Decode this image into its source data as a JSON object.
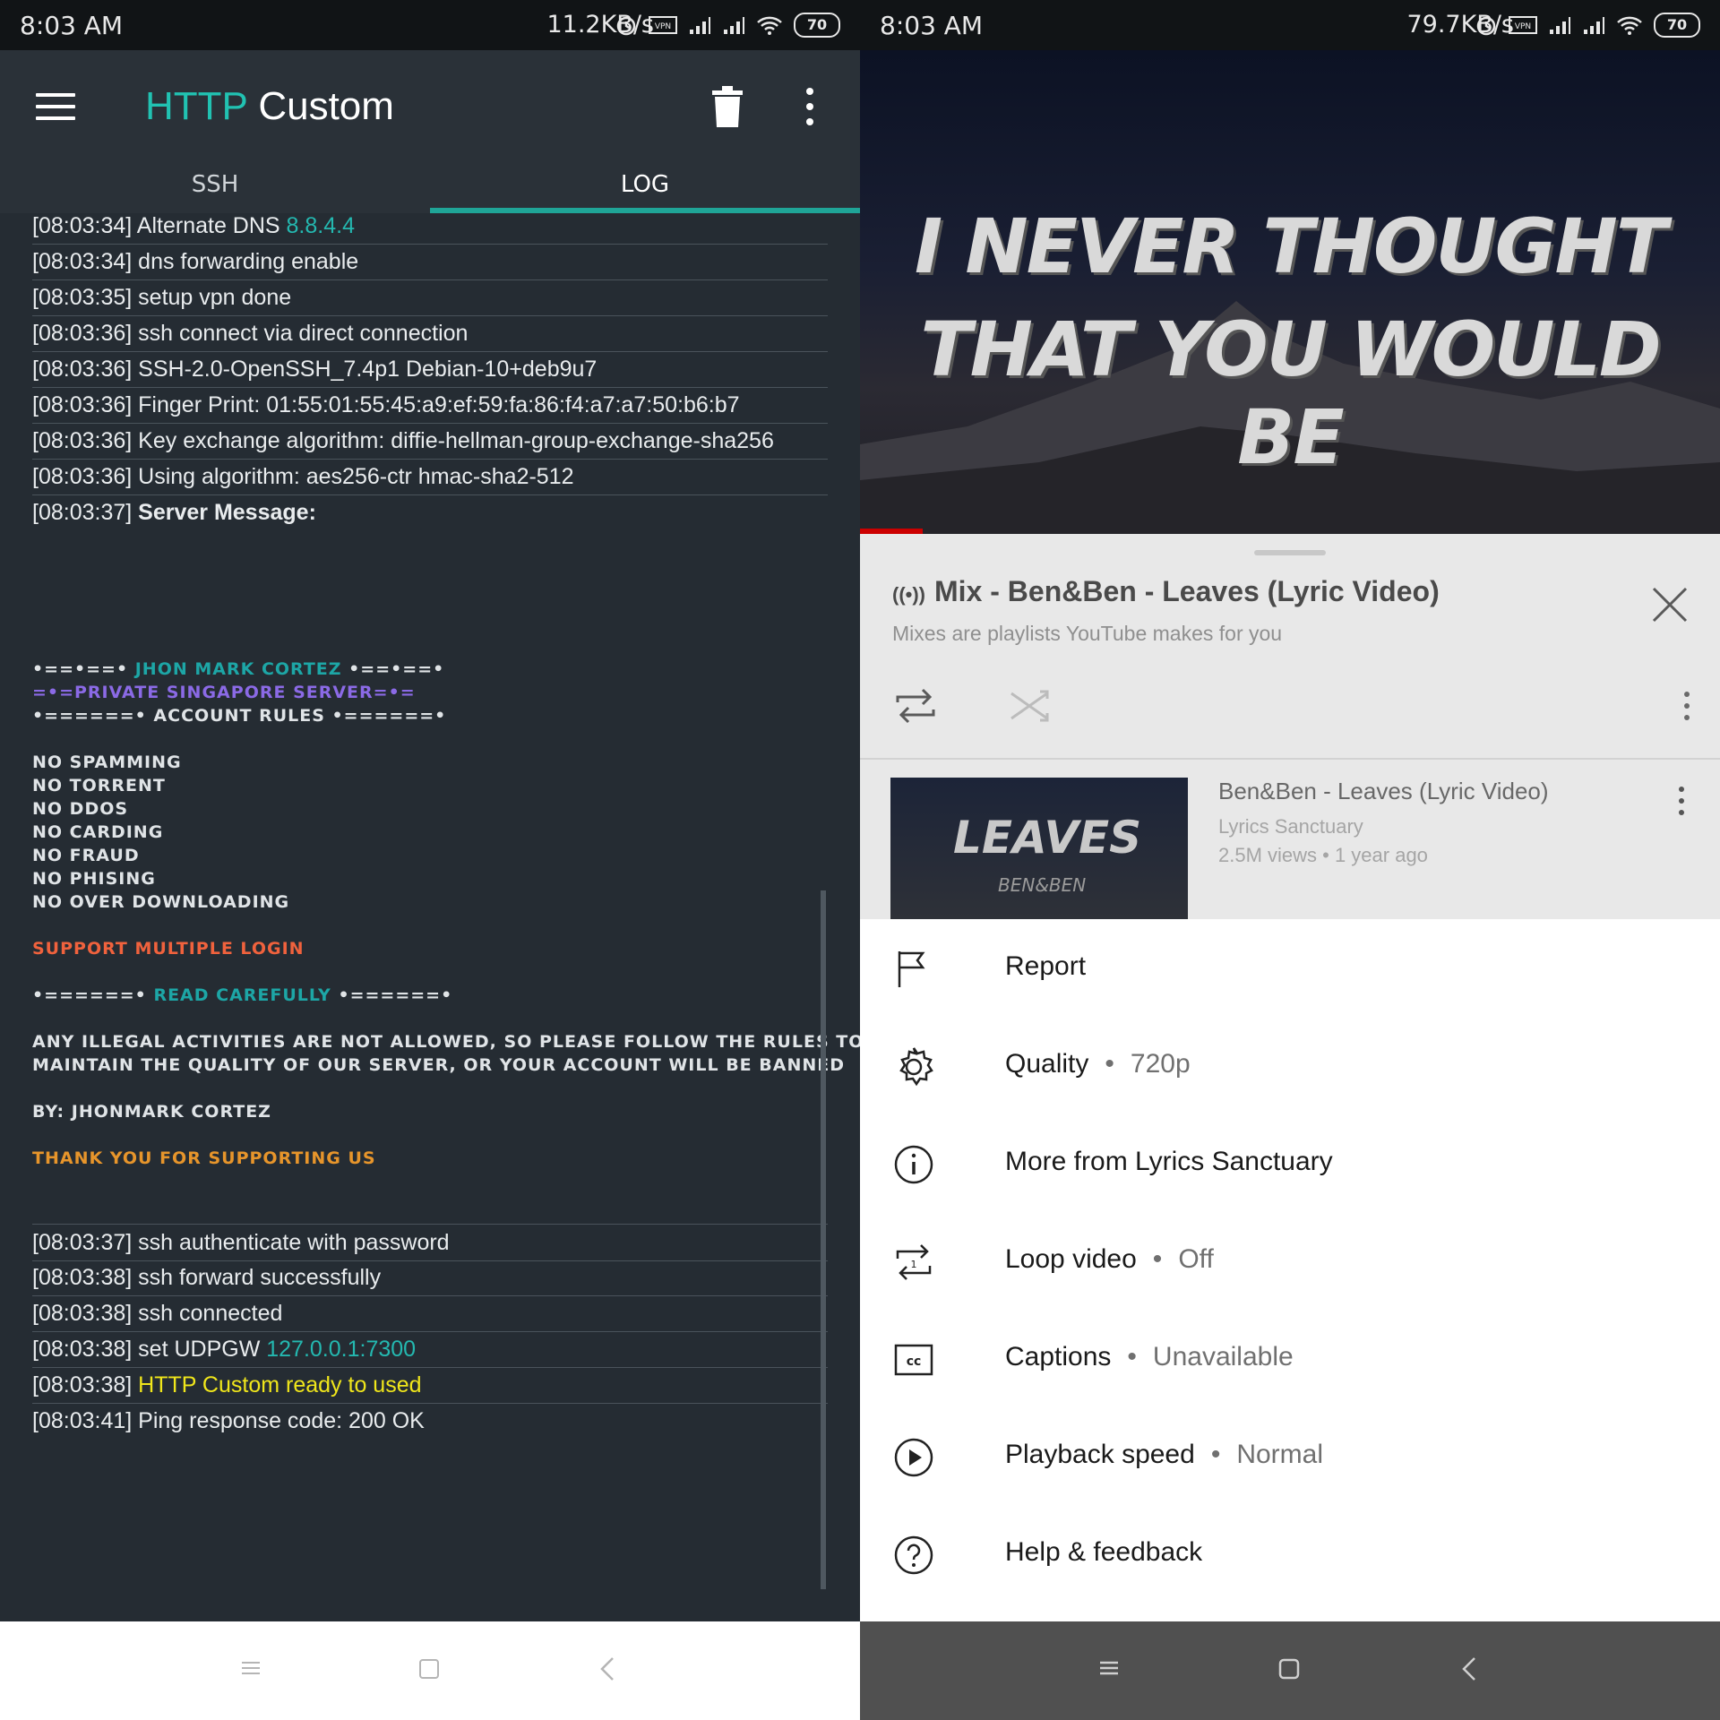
{
  "left": {
    "status": {
      "time": "8:03 AM",
      "net": "11.2KB/s",
      "battery": "70"
    },
    "app": {
      "title_highlight": "HTTP",
      "title_rest": " Custom"
    },
    "tabs": [
      {
        "label": "SSH"
      },
      {
        "label": "LOG"
      }
    ],
    "log_top": [
      {
        "ts": "[08:03:34]",
        "text": " Alternate DNS ",
        "accent": "8.8.4.4"
      },
      {
        "ts": "[08:03:34]",
        "text": " dns forwarding enable"
      },
      {
        "ts": "[08:03:35]",
        "text": " setup vpn done"
      },
      {
        "ts": "[08:03:36]",
        "text": " ssh connect via direct connection"
      },
      {
        "ts": "[08:03:36]",
        "text": " SSH-2.0-OpenSSH_7.4p1 Debian-10+deb9u7"
      },
      {
        "ts": "[08:03:36]",
        "text": " Finger Print: 01:55:01:55:45:a9:ef:59:fa:86:f4:a7:a7:50:b6:b7"
      },
      {
        "ts": "[08:03:36]",
        "text": " Key exchange algorithm: diffie-hellman-group-exchange-sha256"
      },
      {
        "ts": "[08:03:36]",
        "text": " Using algorithm: aes256-ctr hmac-sha2-512"
      },
      {
        "ts": "[08:03:37]",
        "text": " Server Message:"
      }
    ],
    "server_message": {
      "l1_pre": "•==•==• ",
      "l1_name": "JHON MARK CORTEZ",
      "l1_post": " •==•==•",
      "l2": "=•=PRIVATE SINGAPORE SERVER=•=",
      "l3": "•======• ACCOUNT RULES •======•",
      "rules": [
        "NO SPAMMING",
        "NO TORRENT",
        "NO DDOS",
        "NO CARDING",
        "NO FRAUD",
        "NO PHISING",
        "NO OVER DOWNLOADING"
      ],
      "support": "SUPPORT MULTIPLE LOGIN",
      "read_pre": "•======• ",
      "read": "READ CAREFULLY",
      "read_post": " •======•",
      "notice1": "ANY ILLEGAL ACTIVITIES ARE NOT ALLOWED, SO PLEASE FOLLOW THE RULES TO",
      "notice2": "MAINTAIN THE QUALITY OF OUR SERVER, OR YOUR ACCOUNT WILL BE BANNED",
      "by": "BY: JHONMARK CORTEZ",
      "thanks": "THANK YOU FOR SUPPORTING US"
    },
    "log_bottom": [
      {
        "ts": "[08:03:37]",
        "text": " ssh authenticate with password"
      },
      {
        "ts": "[08:03:38]",
        "text": " ssh forward successfully"
      },
      {
        "ts": "[08:03:38]",
        "text": " ssh connected"
      },
      {
        "ts": "[08:03:38]",
        "text": " set UDPGW ",
        "accent": "127.0.0.1:7300"
      },
      {
        "ts": "[08:03:38]",
        "text": " ",
        "yellow": "HTTP Custom ready to used"
      },
      {
        "ts": "[08:03:41]",
        "text": " Ping response code: 200 OK"
      }
    ]
  },
  "right": {
    "status": {
      "time": "8:03 AM",
      "net": "79.7KB/s",
      "battery": "70"
    },
    "lyrics": {
      "line1": "I NEVER THOUGHT",
      "line2": "THAT YOU WOULD BE"
    },
    "mix": {
      "title": "Mix - Ben&Ben - Leaves (Lyric Video)",
      "subtitle": "Mixes are playlists YouTube makes for you"
    },
    "video": {
      "thumb_title": "LEAVES",
      "thumb_sub": "BEN&BEN",
      "title": "Ben&Ben - Leaves (Lyric Video)",
      "channel": "Lyrics Sanctuary",
      "meta": "2.5M views • 1 year ago"
    },
    "menu": [
      {
        "icon": "flag-icon",
        "label": "Report",
        "value": ""
      },
      {
        "icon": "gear-icon",
        "label": "Quality",
        "value": "720p"
      },
      {
        "icon": "info-icon",
        "label": "More from Lyrics Sanctuary",
        "value": ""
      },
      {
        "icon": "loop-icon",
        "label": "Loop video",
        "value": "Off"
      },
      {
        "icon": "captions-icon",
        "label": "Captions",
        "value": "Unavailable"
      },
      {
        "icon": "play-circle-icon",
        "label": "Playback speed",
        "value": "Normal"
      },
      {
        "icon": "help-icon",
        "label": "Help & feedback",
        "value": ""
      }
    ]
  },
  "colors": {
    "teal": "#24b8b0",
    "left_bg": "#252c33",
    "yellow": "#f0e61b",
    "orange": "#f0623d"
  }
}
